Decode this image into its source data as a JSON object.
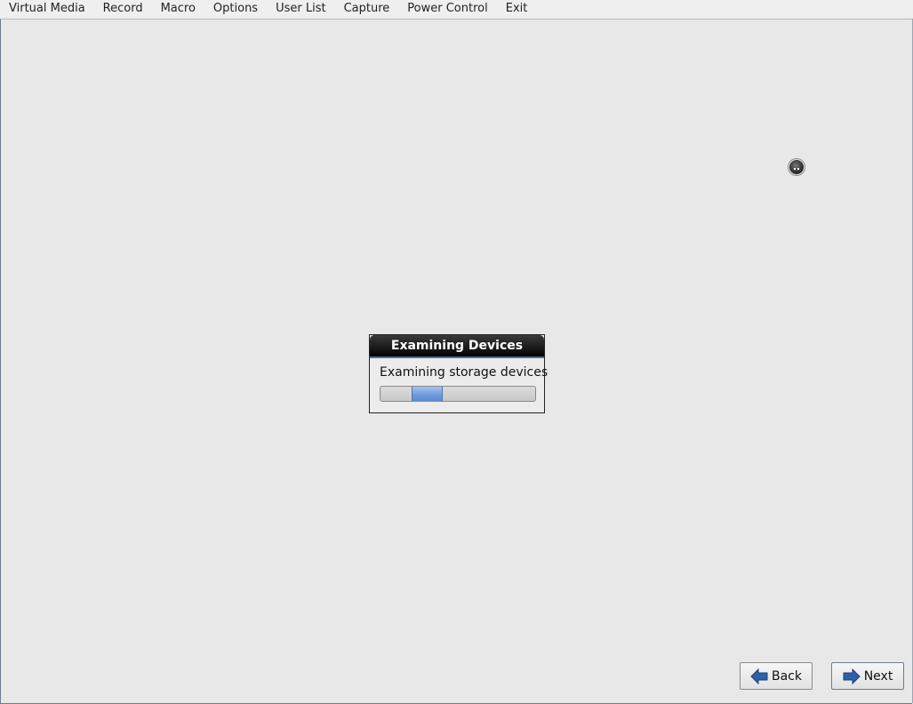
{
  "menubar": {
    "items": [
      "Virtual Media",
      "Record",
      "Macro",
      "Options",
      "User List",
      "Capture",
      "Power Control",
      "Exit"
    ]
  },
  "dialog": {
    "title": "Examining Devices",
    "message": "Examining storage devices",
    "progress": {
      "mode": "indeterminate",
      "pulse_position": 0.2,
      "pulse_width": 0.2
    }
  },
  "buttons": {
    "back_label": "Back",
    "next_label": "Next"
  },
  "icons": {
    "back": "arrow-left-icon",
    "next": "arrow-right-icon",
    "cursor": "busy-cursor-icon"
  },
  "colors": {
    "background": "#e8e8e8",
    "dialog_title_bg": "#141414",
    "progress_pulse": "#6e9bdc",
    "arrow": "#2f5fa6"
  }
}
